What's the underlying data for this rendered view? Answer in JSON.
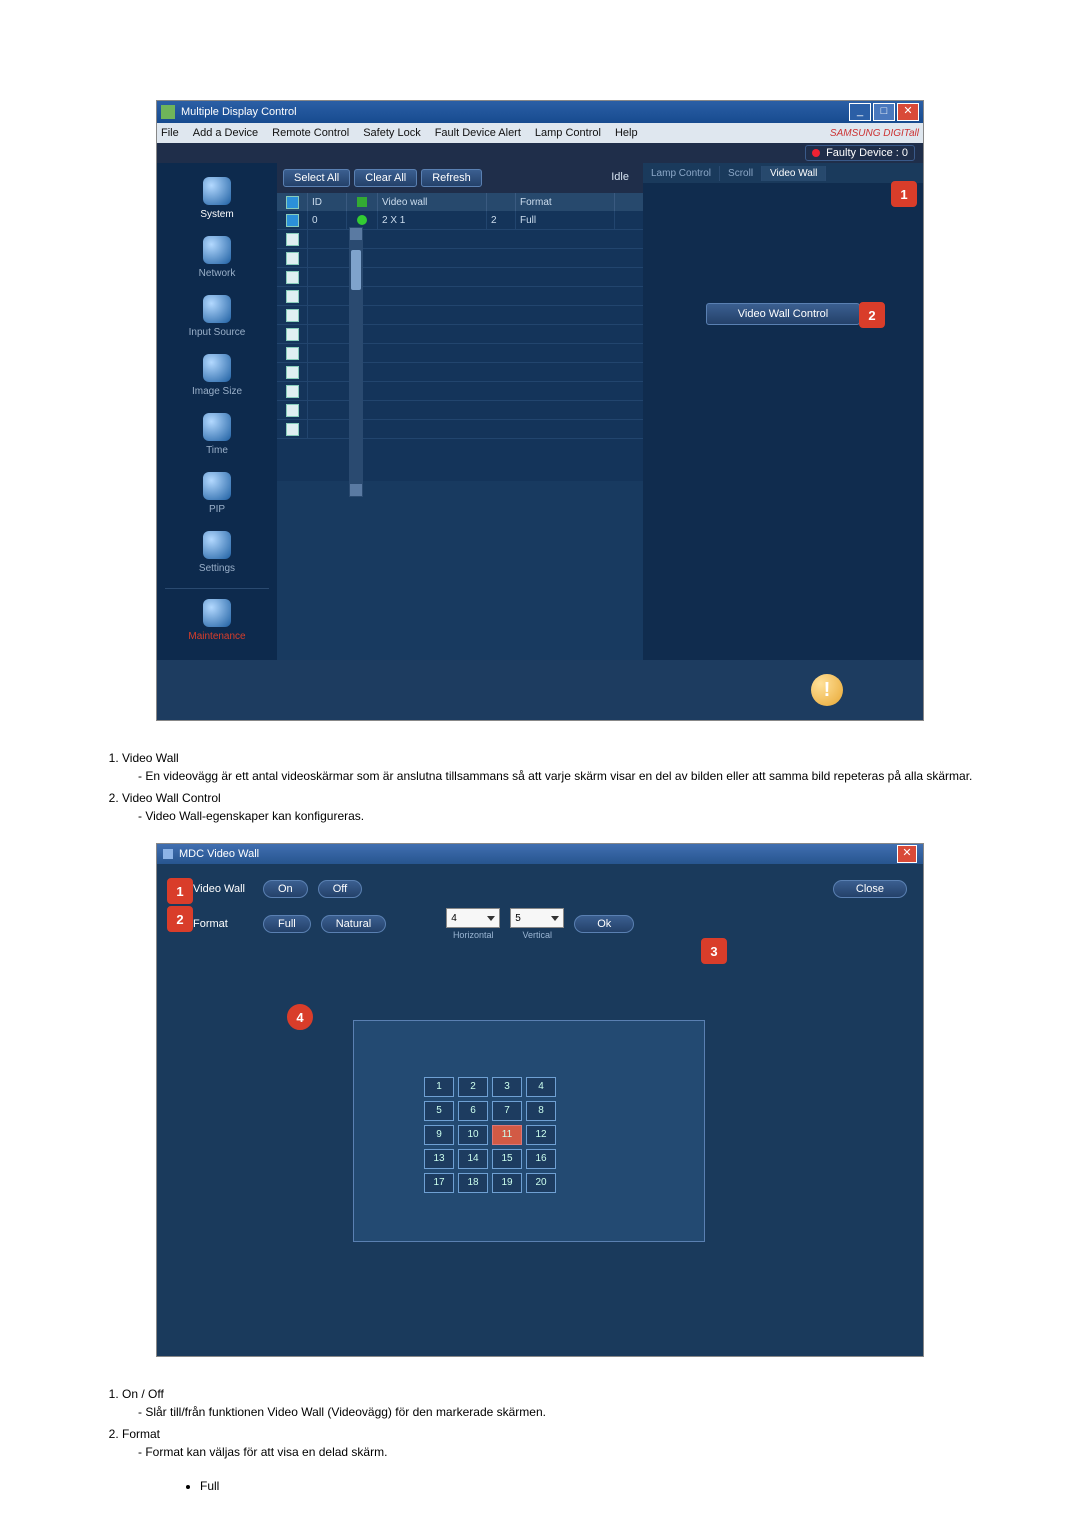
{
  "mdc": {
    "title": "Multiple Display Control",
    "menu": [
      "File",
      "Add a Device",
      "Remote Control",
      "Safety Lock",
      "Fault Device Alert",
      "Lamp Control",
      "Help"
    ],
    "brand": "SAMSUNG DIGITall",
    "faulty": "Faulty Device : 0",
    "toolbar": {
      "select_all": "Select All",
      "clear_all": "Clear All",
      "refresh": "Refresh",
      "idle": "Idle"
    },
    "side": [
      "System",
      "Network",
      "Input Source",
      "Image Size",
      "Time",
      "PIP",
      "Settings",
      "Maintenance"
    ],
    "headers": {
      "id": "ID",
      "vw": "Video wall",
      "fmt": "Format"
    },
    "row": {
      "id": "0",
      "vw": "2 X 1",
      "n": "2",
      "fmt": "Full"
    },
    "tabs": [
      "Lamp Control",
      "Scroll",
      "Video Wall"
    ],
    "vwc_btn": "Video Wall Control"
  },
  "text1": {
    "h1": "Video Wall",
    "p1": "- En videovägg är ett antal videoskärmar som är anslutna tillsammans så att varje skärm visar en del av bilden eller att samma bild repeteras på alla skärmar.",
    "h2": "Video Wall Control",
    "p2": "- Video Wall-egenskaper kan konfigureras."
  },
  "vwdlg": {
    "title": "MDC Video Wall",
    "row1": {
      "label": "Video Wall",
      "on": "On",
      "off": "Off",
      "close": "Close"
    },
    "row2": {
      "label": "Format",
      "full": "Full",
      "natural": "Natural",
      "h": "4",
      "v": "5",
      "ok": "Ok",
      "hl": "Horizontal",
      "vl": "Vertical"
    },
    "cells": [
      "1",
      "2",
      "3",
      "4",
      "5",
      "6",
      "7",
      "8",
      "9",
      "10",
      "11",
      "12",
      "13",
      "14",
      "15",
      "16",
      "17",
      "18",
      "19",
      "20"
    ]
  },
  "text2": {
    "h1": "On / Off",
    "p1": "- Slår till/från funktionen Video Wall (Videovägg) för den markerade skärmen.",
    "h2": "Format",
    "p2": "- Format kan väljas för att visa en delad skärm.",
    "bullet": "Full"
  },
  "callouts": {
    "c1": "1",
    "c2": "2",
    "c3": "3",
    "c4": "4"
  }
}
